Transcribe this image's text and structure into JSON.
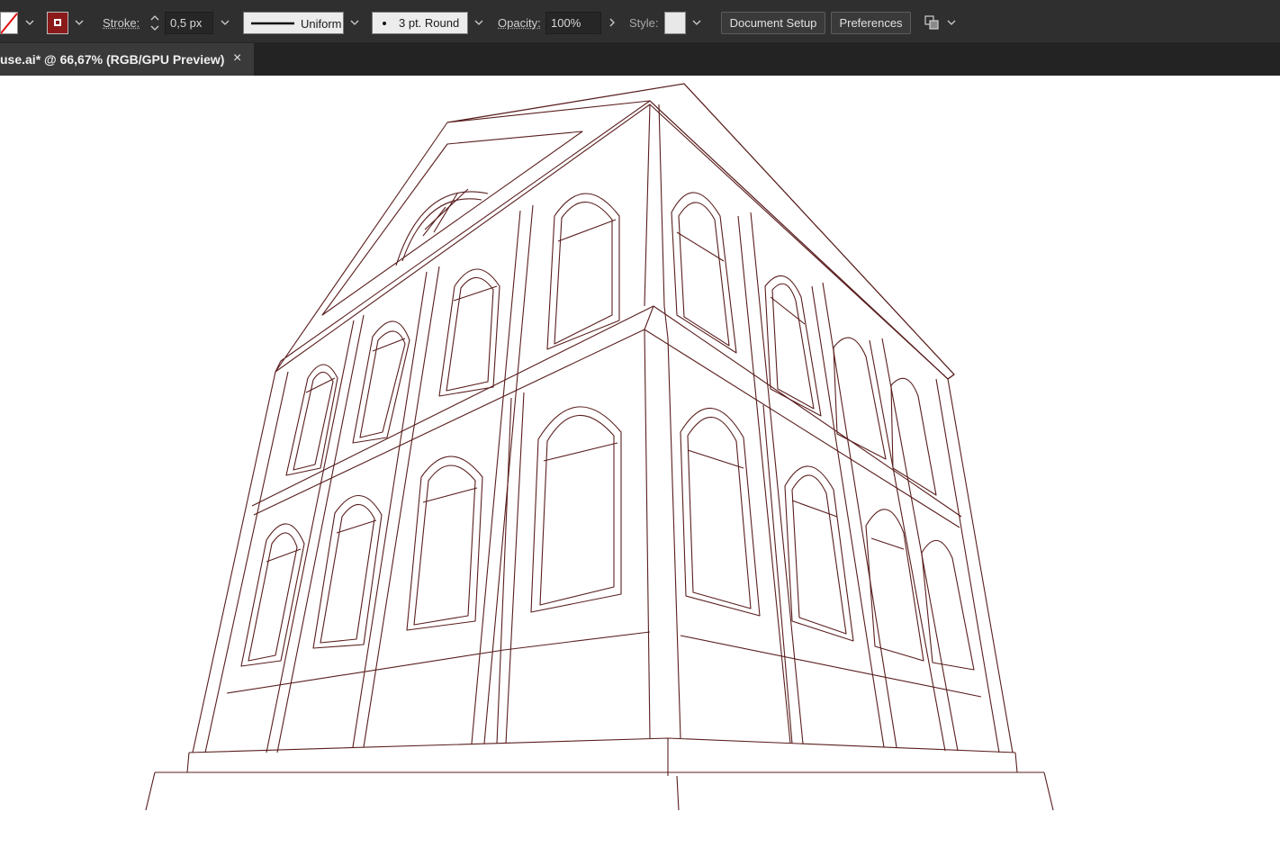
{
  "window": {
    "tab_title": "use.ai* @ 66,67% (RGB/GPU Preview)",
    "tab_close_glyph": "×"
  },
  "control_bar": {
    "fill_swatch_icon": "fill-none-swatch-icon",
    "stroke_swatch_icon": "stroke-swatch-icon",
    "stroke_label": "Stroke:",
    "stroke_weight": "0,5 px",
    "variable_width_profile": "Uniform",
    "brush_definition": "3 pt. Round",
    "opacity_label": "Opacity:",
    "opacity_value": "100%",
    "style_label": "Style:",
    "document_setup_label": "Document Setup",
    "preferences_label": "Preferences",
    "arrange_icon": "arrange-documents-icon",
    "stroke_color": "#8b1a1a",
    "stroke_line_color": "#5a1e1e"
  }
}
